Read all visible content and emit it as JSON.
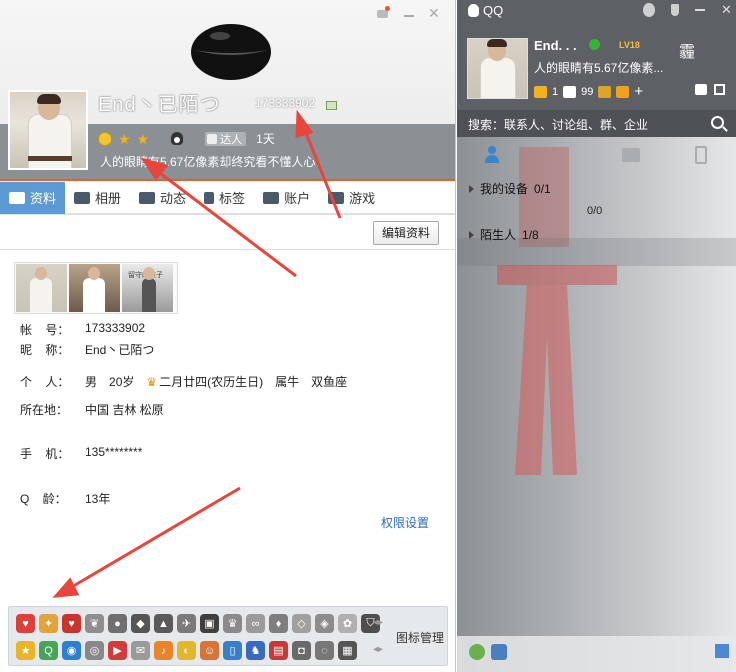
{
  "profile": {
    "nickname": "End丶已陌つ",
    "qq_number": "173333902",
    "talent_badge": "达人",
    "days": "1天",
    "signature": "人的眼睛有5.67亿像素却终究看不懂人心",
    "tabs": [
      {
        "label": "资料",
        "icon": "profile-card-icon"
      },
      {
        "label": "相册",
        "icon": "photo-album-icon"
      },
      {
        "label": "动态",
        "icon": "list-icon"
      },
      {
        "label": "标签",
        "icon": "bookmark-icon"
      },
      {
        "label": "账户",
        "icon": "wallet-icon"
      },
      {
        "label": "游戏",
        "icon": "game-icon"
      }
    ],
    "edit_button": "编辑资料",
    "photo_caption": "留守的孩子",
    "fields": {
      "account_label": "帐    号：",
      "account_value": "173333902",
      "nick_label": "昵    称：",
      "nick_value": "End丶已陌つ",
      "personal_label": "个    人：",
      "gender": "男",
      "age": "20岁",
      "birthday": "二月廿四(农历生日)",
      "zodiac": "属牛",
      "constellation": "双鱼座",
      "location_label": "所在地：",
      "location_value": "中国 吉林 松原",
      "phone_label": "手    机：",
      "phone_value": "135********",
      "qage_label": "Q    龄：",
      "qage_value": "13年"
    },
    "permission_link": "权限设置",
    "badge_manage": "图标管理",
    "accent": "#5d9ad4",
    "banner_line_color": "#e2632a",
    "annotation_arrow_color": "#e8453c"
  },
  "qq": {
    "title": "QQ",
    "nickname": "End. . .",
    "level": "LV18",
    "weather_glyph": "霾",
    "signature": "人的眼睛有5.67亿像素...",
    "status": {
      "stars": "1",
      "mail": "99"
    },
    "search_placeholder": "搜索：联系人、讨论组、群、企业",
    "groups": [
      {
        "name": "我的设备",
        "count": "0/1"
      },
      {
        "name": "陌生人",
        "count": "1/8"
      }
    ],
    "devices_sub": "0/0",
    "online_color": "#37b437"
  }
}
